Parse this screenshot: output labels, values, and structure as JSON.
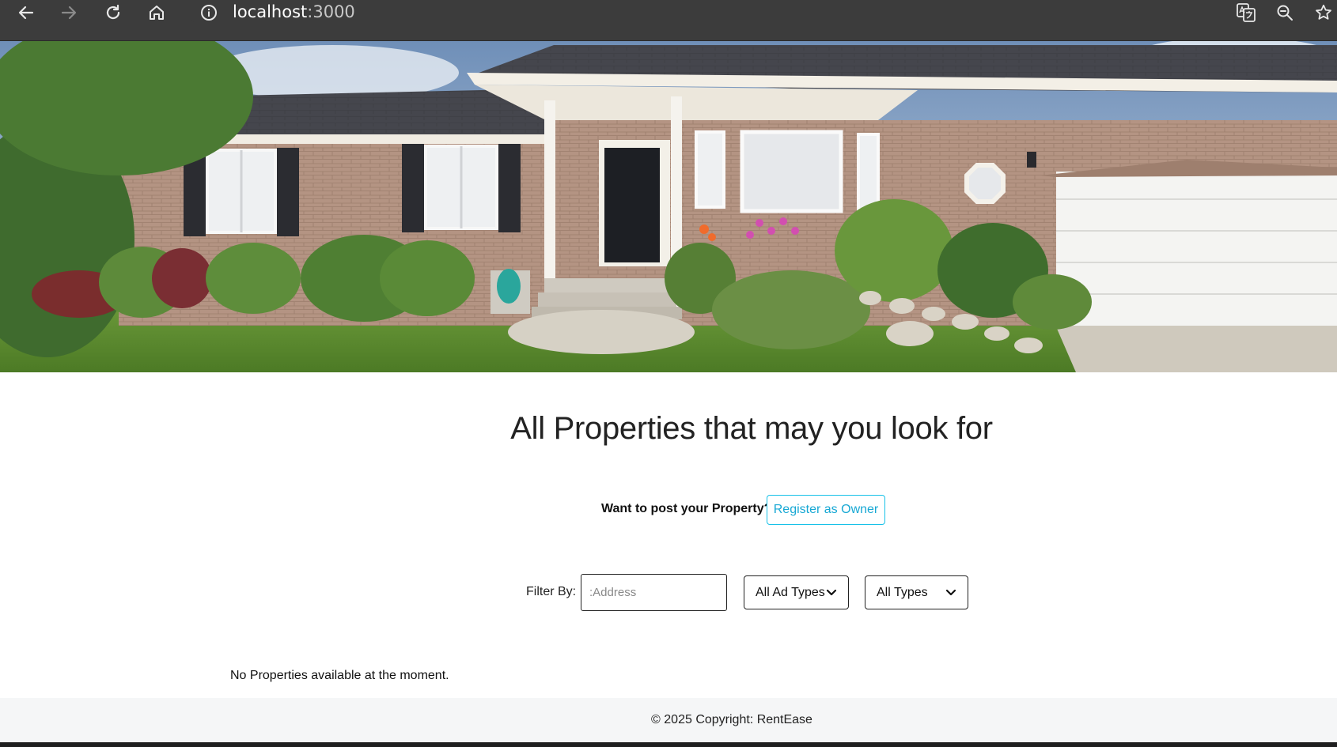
{
  "browser": {
    "url_host": "localhost",
    "url_port": ":3000",
    "icons": [
      "back-arrow-icon",
      "forward-arrow-icon",
      "reload-icon",
      "home-icon",
      "site-info-icon",
      "translate-icon",
      "zoom-icon",
      "bookmark-star-icon"
    ]
  },
  "hero": {
    "slide_count": 4,
    "active_slide": 1
  },
  "main": {
    "heading": "All Properties that may you look for",
    "owner_prompt": "Want to post your Property?",
    "owner_button": "Register as Owner",
    "filter": {
      "label": "Filter By:",
      "address_placeholder": ":Address",
      "ad_type_selected": "All Ad Types",
      "type_selected": "All Types"
    },
    "empty_message": "No Properties available at the moment."
  },
  "footer": {
    "copyright": "© 2025 Copyright: RentEase"
  },
  "colors": {
    "accent": "#17c1e8",
    "chrome_bg": "#3c3c3c",
    "footer_bg": "#f5f6f7"
  }
}
